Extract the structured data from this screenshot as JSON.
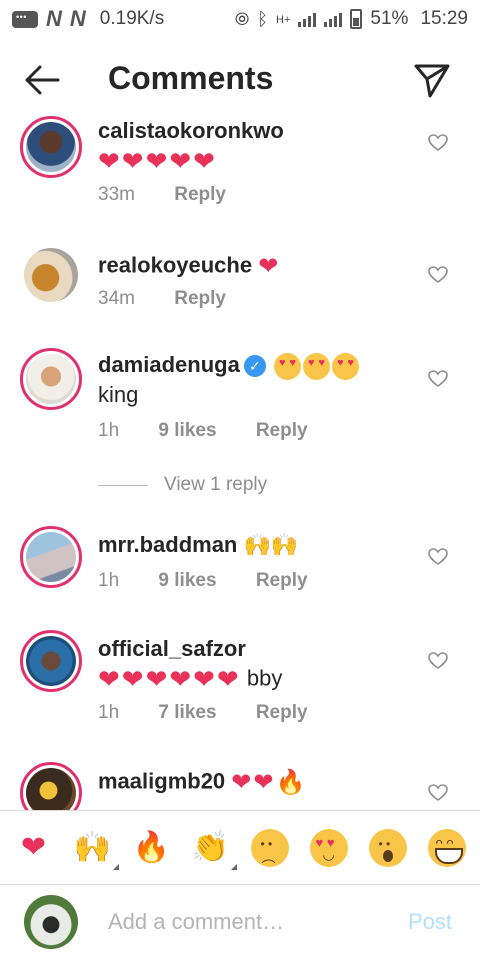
{
  "status_bar": {
    "network_speed": "0.19K/s",
    "network_type": "H+",
    "battery": "51%",
    "time": "15:29",
    "n_badge_1": "N",
    "n_badge_2": "N"
  },
  "header": {
    "title": "Comments"
  },
  "comments": [
    {
      "username": "calistaokoronkwo",
      "text": "❤❤❤❤❤",
      "time": "33m",
      "likes": "",
      "reply": "Reply"
    },
    {
      "username": "realokoyeuche",
      "text": "❤",
      "time": "34m",
      "likes": "",
      "reply": "Reply"
    },
    {
      "username": "damiadenuga",
      "text": "king",
      "time": "1h",
      "likes": "9 likes",
      "reply": "Reply",
      "verified": true
    },
    {
      "username": "mrr.baddman",
      "text": "🙌🙌",
      "time": "1h",
      "likes": "9 likes",
      "reply": "Reply"
    },
    {
      "username": "official_safzor",
      "text": "❤❤❤❤❤❤",
      "text_suffix": "bby",
      "time": "1h",
      "likes": "7 likes",
      "reply": "Reply"
    },
    {
      "username": "maaligmb20",
      "text": "❤❤🔥",
      "time": "",
      "likes": "",
      "reply": ""
    }
  ],
  "view_replies": "View 1 reply",
  "quick_emojis": [
    "❤",
    "🙌",
    "🔥",
    "👏",
    "😢",
    "😍",
    "😮",
    "😂"
  ],
  "input": {
    "placeholder": "Add a comment…",
    "post_label": "Post"
  },
  "colors": {
    "text": "#262626",
    "secondary": "#8e8e8e",
    "story_ring": "#e1306c",
    "heart": "#e8325a",
    "verified": "#3897f0",
    "post_disabled": "#b2dffc"
  }
}
